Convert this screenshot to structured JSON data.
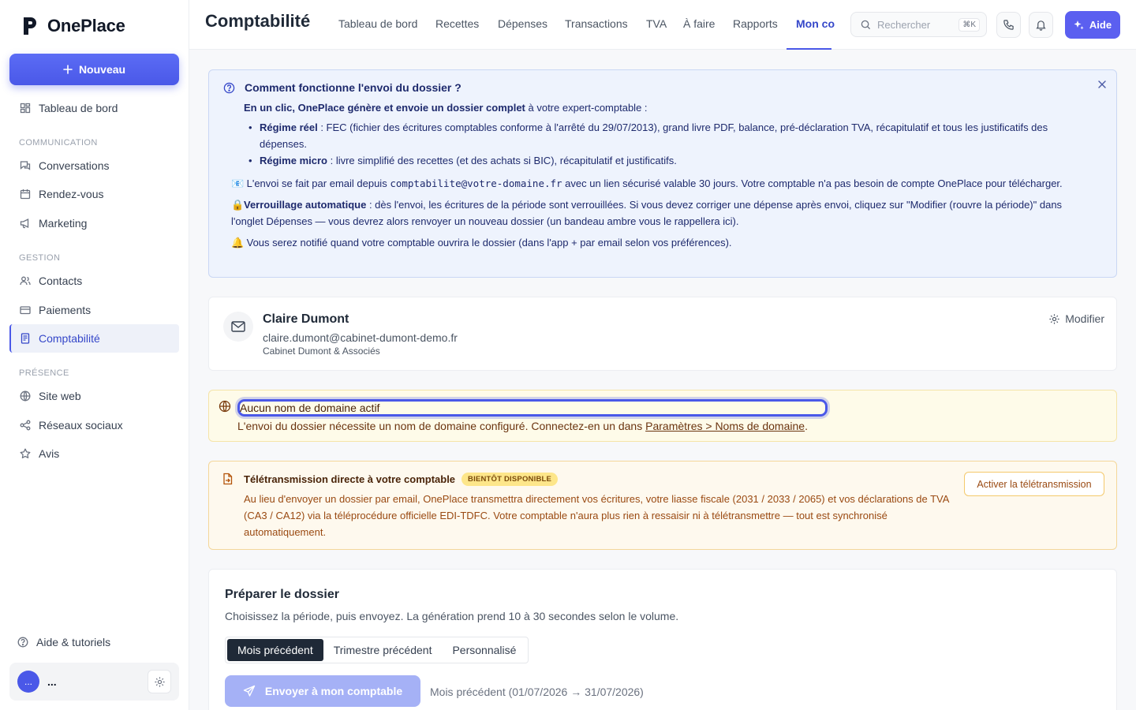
{
  "brand": {
    "name": "OnePlace"
  },
  "sidebar": {
    "new_label": "Nouveau",
    "items_top": [
      {
        "label": "Tableau de bord",
        "icon": "dashboard-icon"
      }
    ],
    "section_communication": "COMMUNICATION",
    "items_communication": [
      {
        "label": "Conversations",
        "icon": "chat-icon"
      },
      {
        "label": "Rendez-vous",
        "icon": "calendar-icon"
      },
      {
        "label": "Marketing",
        "icon": "megaphone-icon"
      }
    ],
    "section_gestion": "GESTION",
    "items_gestion": [
      {
        "label": "Contacts",
        "icon": "users-icon"
      },
      {
        "label": "Paiements",
        "icon": "card-icon"
      },
      {
        "label": "Comptabilité",
        "icon": "ledger-icon",
        "active": true
      }
    ],
    "section_presence": "PRÉSENCE",
    "items_presence": [
      {
        "label": "Site web",
        "icon": "globe-icon"
      },
      {
        "label": "Réseaux sociaux",
        "icon": "share-icon"
      },
      {
        "label": "Avis",
        "icon": "star-icon"
      }
    ],
    "help_label": "Aide & tutoriels",
    "user": {
      "initials": "...",
      "name": "..."
    }
  },
  "header": {
    "title": "Comptabilité",
    "tabs": [
      "Tableau de bord",
      "Recettes",
      "Dépenses",
      "Transactions",
      "TVA",
      "À faire",
      "Rapports",
      "Mon co"
    ],
    "active_tab": "Mon co",
    "search_placeholder": "Rechercher",
    "search_shortcut": "⌘K",
    "help_label": "Aide"
  },
  "info": {
    "title": "Comment fonctionne l'envoi du dossier ?",
    "intro_bold": "En un clic, OnePlace génère et envoie un dossier complet",
    "intro_rest": " à votre expert-comptable :",
    "bullet1_bold": "Régime réel",
    "bullet1_text": " : FEC (fichier des écritures comptables conforme à l'arrêté du 29/07/2013), grand livre PDF, balance, pré-déclaration TVA, récapitulatif et tous les justificatifs des dépenses.",
    "bullet2_bold": "Régime micro",
    "bullet2_text": " : livre simplifié des recettes (et des achats si BIC), récapitulatif et justificatifs.",
    "email_emoji": "📧",
    "email_pre": " L'envoi se fait par email depuis ",
    "email_address": "comptabilite@votre-domaine.fr",
    "email_post": " avec un lien sécurisé valable 30 jours. Votre comptable n'a pas besoin de compte OnePlace pour télécharger.",
    "lock_emoji": "🔒",
    "lock_bold": "Verrouillage automatique",
    "lock_text": " : dès l'envoi, les écritures de la période sont verrouillées. Si vous devez corriger une dépense après envoi, cliquez sur \"Modifier (rouvre la période)\" dans l'onglet Dépenses — vous devrez alors renvoyer un nouveau dossier (un bandeau ambre vous le rappellera ici).",
    "bell_emoji": "🔔",
    "bell_text": " Vous serez notifié quand votre comptable ouvrira le dossier (dans l'app + par email selon vos préférences)."
  },
  "accountant": {
    "name": "Claire Dumont",
    "email": "claire.dumont@cabinet-dumont-demo.fr",
    "firm": "Cabinet Dumont & Associés",
    "edit_label": "Modifier"
  },
  "domain_warning": {
    "title": "Aucun nom de domaine actif",
    "text": "L'envoi du dossier nécessite un nom de domaine configuré. Connectez-en un dans ",
    "link": "Paramètres > Noms de domaine",
    "text_end": "."
  },
  "teletransmission": {
    "title": "Télétransmission directe à votre comptable",
    "badge": "BIENTÔT DISPONIBLE",
    "text": "Au lieu d'envoyer un dossier par email, OnePlace transmettra directement vos écritures, votre liasse fiscale (2031 / 2033 / 2065) et vos déclarations de TVA (CA3 / CA12) via la téléprocédure officielle EDI-TDFC. Votre comptable n'aura plus rien à ressaisir ni à télétransmettre — tout est synchronisé automatiquement.",
    "button": "Activer la télétransmission"
  },
  "prepare": {
    "title": "Préparer le dossier",
    "subtitle": "Choisissez la période, puis envoyez. La génération prend 10 à 30 secondes selon le volume.",
    "periods": [
      "Mois précédent",
      "Trimestre précédent",
      "Personnalisé"
    ],
    "selected_period": "Mois précédent",
    "send_label": "Envoyer à mon comptable",
    "period_summary": "Mois précédent (01/07/2026 → 31/07/2026)"
  }
}
